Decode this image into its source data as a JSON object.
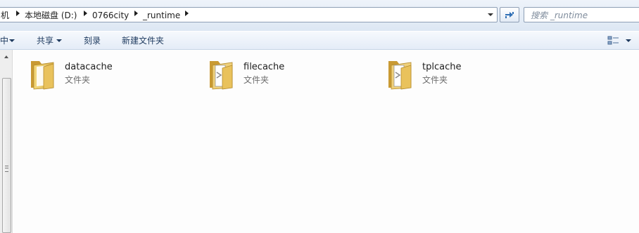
{
  "address_bar": {
    "crumbs": [
      {
        "label": "机"
      },
      {
        "label": "本地磁盘 (D:)"
      },
      {
        "label": "0766city"
      },
      {
        "label": "_runtime"
      }
    ]
  },
  "search": {
    "placeholder": "搜索 _runtime"
  },
  "toolbar": {
    "cut_off_label": "中",
    "share_label": "共享",
    "burn_label": "刻录",
    "new_folder_label": "新建文件夹"
  },
  "files": [
    {
      "name": "datacache",
      "type": "文件夹",
      "icon": "folder-icon"
    },
    {
      "name": "filecache",
      "type": "文件夹",
      "icon": "folder-with-documents-icon"
    },
    {
      "name": "tplcache",
      "type": "文件夹",
      "icon": "folder-with-documents-icon"
    }
  ],
  "colors": {
    "chrome_top": "#dde7f3",
    "command_bar": "#e4ecf7",
    "content_bg": "#fdfdfd",
    "folder_yellow": "#e8c560"
  }
}
